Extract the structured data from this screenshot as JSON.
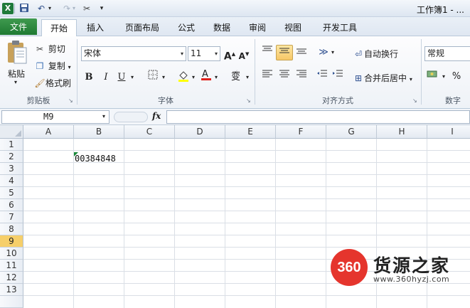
{
  "title_bar": {
    "window_title": "工作簿1 - ...",
    "excel_logo": "X"
  },
  "tabs": [
    "文件",
    "开始",
    "插入",
    "页面布局",
    "公式",
    "数据",
    "审阅",
    "视图",
    "开发工具"
  ],
  "ribbon": {
    "clipboard": {
      "paste_label": "粘贴",
      "cut_label": "剪切",
      "copy_label": "复制",
      "format_painter_label": "格式刷",
      "group_label": "剪贴板"
    },
    "font": {
      "font_name": "宋体",
      "font_size": "11",
      "grow_label": "A",
      "shrink_label": "A",
      "bold_label": "B",
      "italic_label": "I",
      "underline_label": "U",
      "phonetic_label": "wén",
      "group_label": "字体"
    },
    "alignment": {
      "wrap_text_label": "自动换行",
      "merge_center_label": "合并后居中",
      "group_label": "对齐方式"
    },
    "number": {
      "format_value": "常规",
      "percent_label": "%",
      "group_label": "数字"
    }
  },
  "formula_bar": {
    "name_box": "M9",
    "fx_label": "fx",
    "formula": ""
  },
  "grid": {
    "columns": [
      "A",
      "B",
      "C",
      "D",
      "E",
      "F",
      "G",
      "H",
      "I"
    ],
    "rows": [
      "1",
      "2",
      "3",
      "4",
      "5",
      "6",
      "7",
      "8",
      "9",
      "10",
      "11",
      "12",
      "13"
    ],
    "active_row": "9",
    "cells": {
      "B2": "00384848"
    }
  },
  "watermark": {
    "logo_text": "360",
    "site_name": "货源之家",
    "url": "www.360hyzj.com"
  },
  "colors": {
    "file_tab": "#1f7a32",
    "active_header": "#f6cf6a",
    "watermark_red": "#e5352d"
  }
}
